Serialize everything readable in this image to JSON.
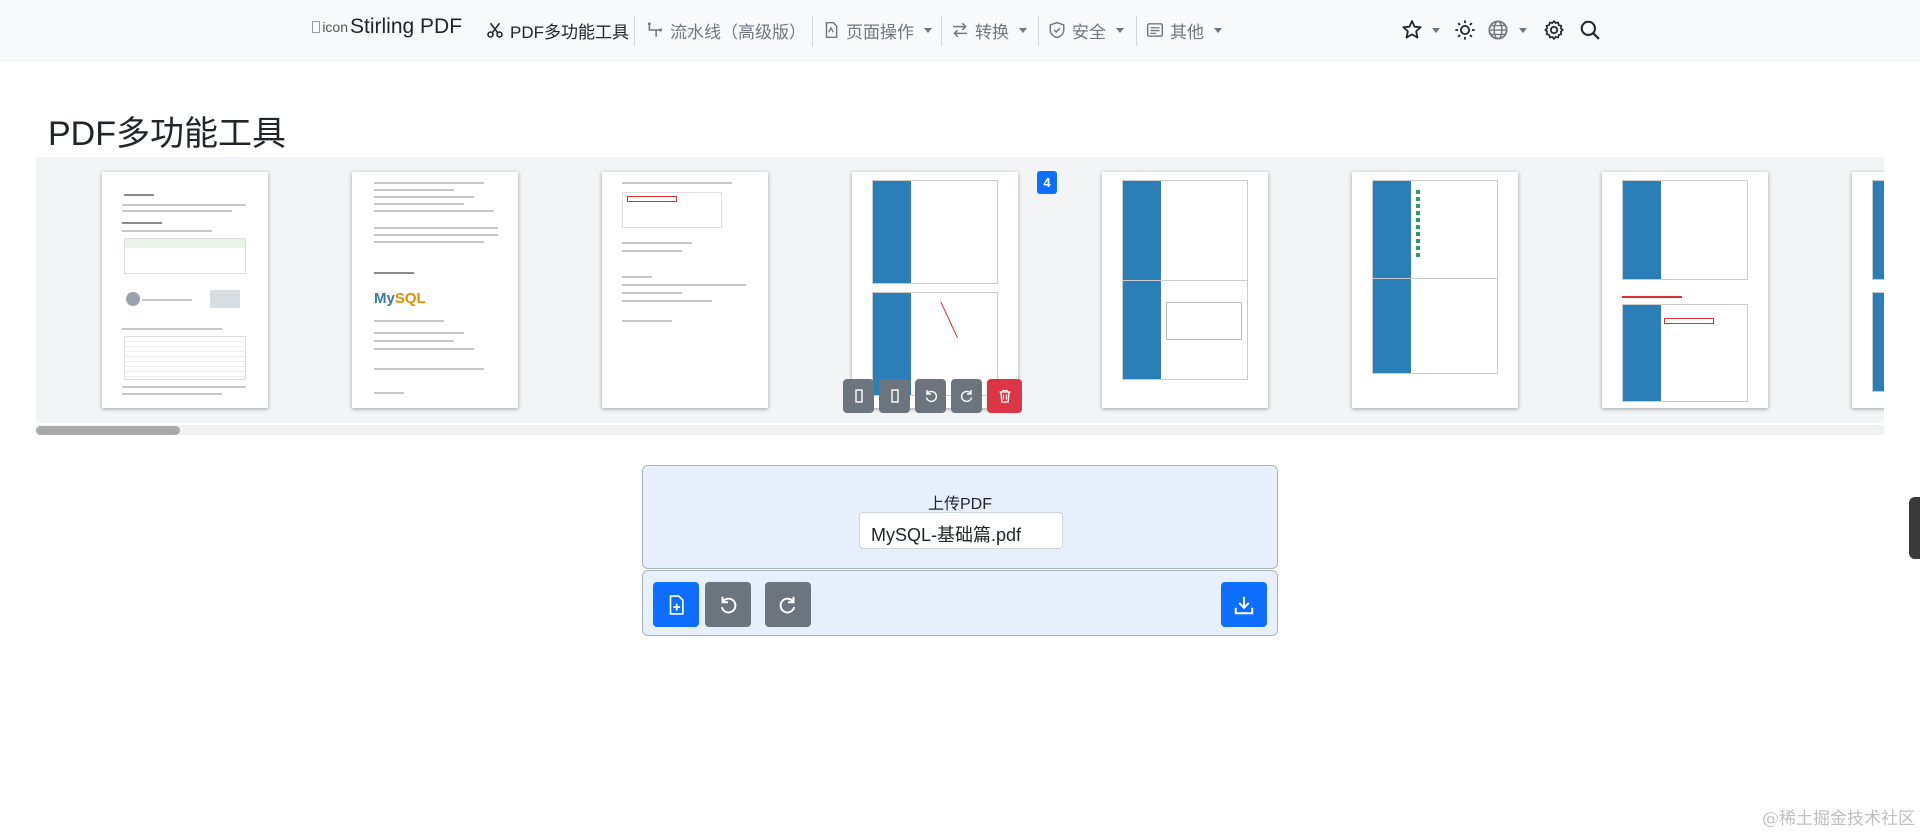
{
  "navbar": {
    "brand": "Stirling PDF",
    "brand_logo_alt": "icon",
    "items": [
      {
        "label": "PDF多功能工具",
        "icon": "scissors-icon"
      },
      {
        "label": "流水线（高级版）",
        "icon": "pipeline-icon"
      },
      {
        "label": "页面操作",
        "icon": "file-icon"
      },
      {
        "label": "转换",
        "icon": "convert-icon"
      },
      {
        "label": "安全",
        "icon": "shield-icon"
      },
      {
        "label": "其他",
        "icon": "list-icon"
      }
    ],
    "right_icons": [
      "star-icon",
      "sun-icon",
      "globe-icon",
      "gear-icon",
      "search-icon"
    ]
  },
  "page_title": "PDF多功能工具",
  "strip": {
    "highlighted_page_number": "4",
    "page_tools": [
      "move-left-icon",
      "move-right-icon",
      "rotate-left-icon",
      "rotate-right-icon",
      "trash-icon"
    ]
  },
  "upload": {
    "label": "上传PDF",
    "file_name": "MySQL-基础篇.pdf"
  },
  "actions": [
    "add-file-icon",
    "rotate-left-icon",
    "rotate-right-icon",
    "download-icon"
  ],
  "colors": {
    "primary": "#0d6efd",
    "secondary": "#6c757d",
    "danger": "#dc3545",
    "panel": "#e7effd"
  },
  "watermark": "@稀土掘金技术社区"
}
